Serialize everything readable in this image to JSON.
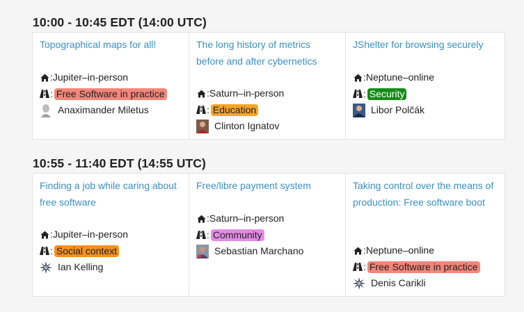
{
  "slots": [
    {
      "title": "10:00 - 10:45 EDT (14:00 UTC)",
      "talks": [
        {
          "title": "Topographical maps for all!",
          "room": "Jupiter",
          "mode": "in-person",
          "track": "Free Software in practice",
          "track_color": "#f4857a",
          "track_text_color": "#222222",
          "speaker": "Anaximander Miletus",
          "avatar": "bust-avatar"
        },
        {
          "title": "The long history of metrics before and after cybernetics",
          "room": "Saturn",
          "mode": "in-person",
          "track": "Education",
          "track_color": "#f6a52a",
          "track_text_color": "#222222",
          "speaker": "Clinton Ignatov",
          "avatar": "photo-avatar"
        },
        {
          "title": "JShelter for browsing securely",
          "room": "Neptune",
          "mode": "online",
          "track": "Security",
          "track_color": "#148d14",
          "track_text_color": "#ffffff",
          "speaker": "Libor Polčák",
          "avatar": "photo-avatar"
        }
      ]
    },
    {
      "title": "10:55 - 11:40 EDT (14:55 UTC)",
      "talks": [
        {
          "title": "Finding a job while caring about free software",
          "room": "Jupiter",
          "mode": "in-person",
          "track": "Social context",
          "track_color": "#f5901e",
          "track_text_color": "#222222",
          "speaker": "Ian Kelling",
          "avatar": "star-avatar"
        },
        {
          "title": "Free/libre payment system",
          "room": "Saturn",
          "mode": "in-person",
          "track": "Community",
          "track_color": "#e58be7",
          "track_text_color": "#222222",
          "speaker": "Sebastian Marchano",
          "avatar": "photo-avatar"
        },
        {
          "title": "Taking control over the means of production: Free software boot",
          "room": "Neptune",
          "mode": "online",
          "track": "Free Software in practice",
          "track_color": "#f4857a",
          "track_text_color": "#222222",
          "speaker": "Denis Carikli",
          "avatar": "star-avatar"
        }
      ]
    }
  ],
  "labels": {
    "separator": " – ",
    "colon": ": "
  },
  "icons": {
    "room": "house-icon",
    "track": "road-icon"
  }
}
